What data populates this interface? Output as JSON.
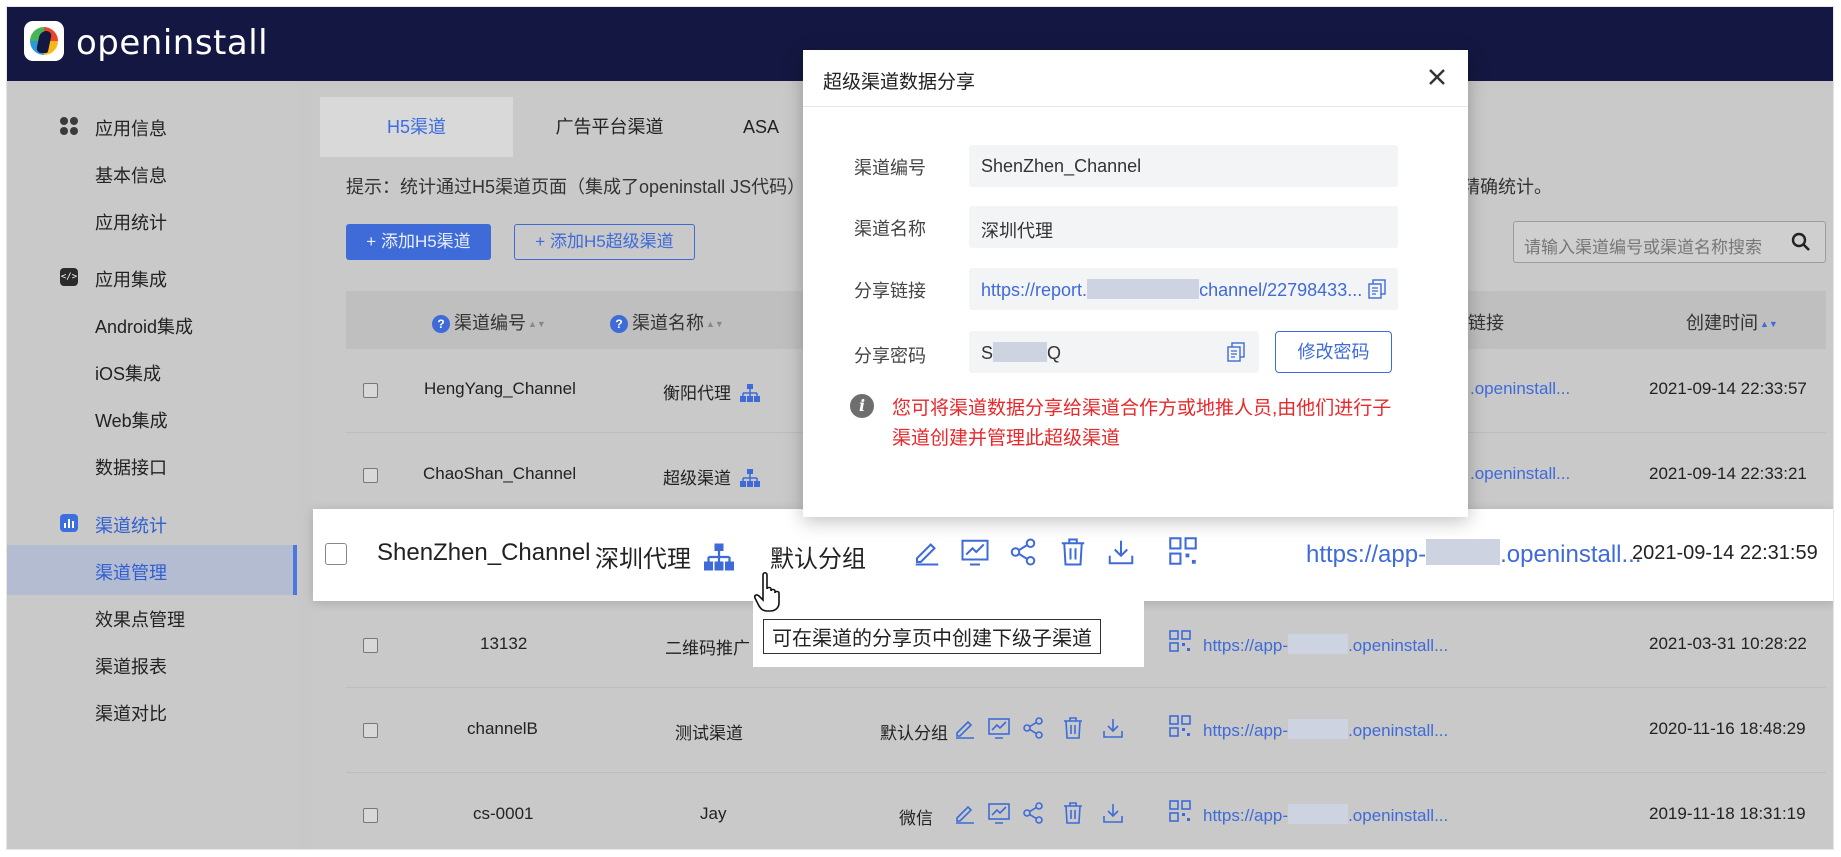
{
  "app": {
    "brand": "openinstall"
  },
  "sidebar": {
    "items": [
      {
        "label": "应用信息",
        "icon": "apps-icon",
        "group": true
      },
      {
        "label": "基本信息"
      },
      {
        "label": "应用统计"
      },
      {
        "label": "应用集成",
        "icon": "code-icon",
        "group": true
      },
      {
        "label": "Android集成"
      },
      {
        "label": "iOS集成"
      },
      {
        "label": "Web集成"
      },
      {
        "label": "数据接口"
      },
      {
        "label": "渠道统计",
        "icon": "chart-icon",
        "group": true,
        "active": true
      },
      {
        "label": "渠道管理",
        "selected": true
      },
      {
        "label": "效果点管理"
      },
      {
        "label": "渠道报表"
      },
      {
        "label": "渠道对比"
      }
    ]
  },
  "tabs": [
    {
      "label": "H5渠道",
      "active": true
    },
    {
      "label": "广告平台渠道"
    },
    {
      "label": "ASA"
    }
  ],
  "tip": {
    "left": "提示：统计通过H5渠道页面（集成了openinstall JS代码）带",
    "right": "精确统计。"
  },
  "toolbar": {
    "add_h5": "+ 添加H5渠道",
    "add_h5_super": "+ 添加H5超级渠道",
    "search_placeholder": "请输入渠道编号或渠道名称搜索"
  },
  "table": {
    "headers": {
      "code": "渠道编号",
      "name": "渠道名称",
      "link": "链接",
      "created": "创建时间"
    },
    "rows": [
      {
        "code": "HengYang_Channel",
        "name": "衡阳代理",
        "group": "",
        "link": ".openinstall...",
        "created": "2021-09-14 22:33:57"
      },
      {
        "code": "ChaoShan_Channel",
        "name": "超级渠道",
        "group": "",
        "link": ".openinstall...",
        "created": "2021-09-14 22:33:21"
      },
      {
        "code": "13132",
        "name": "二维码推广",
        "group": "",
        "link_prefix": "https://app-",
        "link": ".openinstall...",
        "created": "2021-03-31 10:28:22"
      },
      {
        "code": "channelB",
        "name": "测试渠道",
        "group": "默认分组",
        "link_prefix": "https://app-",
        "link": ".openinstall...",
        "created": "2020-11-16 18:48:29"
      },
      {
        "code": "cs-0001",
        "name": "Jay",
        "group": "微信",
        "link_prefix": "https://app-",
        "link": ".openinstall...",
        "created": "2019-11-18 18:31:19"
      }
    ],
    "highlight_row": {
      "code": "ShenZhen_Channel",
      "name": "深圳代理",
      "group": "默认分组",
      "link_prefix": "https://app-",
      "link": ".openinstall...",
      "created": "2021-09-14 22:31:59"
    }
  },
  "tooltip": {
    "text": "可在渠道的分享页中创建下级子渠道"
  },
  "modal": {
    "title": "超级渠道数据分享",
    "fields": {
      "code_label": "渠道编号",
      "code_value": "ShenZhen_Channel",
      "name_label": "渠道名称",
      "name_value": "深圳代理",
      "link_label": "分享链接",
      "link_prefix": "https://report.",
      "link_suffix": "channel/22798433...",
      "pw_label": "分享密码",
      "pw_prefix": "S",
      "pw_suffix": "Q"
    },
    "change_pw_button": "修改密码",
    "info_icon": "i",
    "warning": "您可将渠道数据分享给渠道合作方或地推人员,由他们进行子渠道创建并管理此超级渠道"
  },
  "colors": {
    "accent": "#3e6bd8",
    "header_bg": "#141741",
    "warning": "#e8282b"
  }
}
